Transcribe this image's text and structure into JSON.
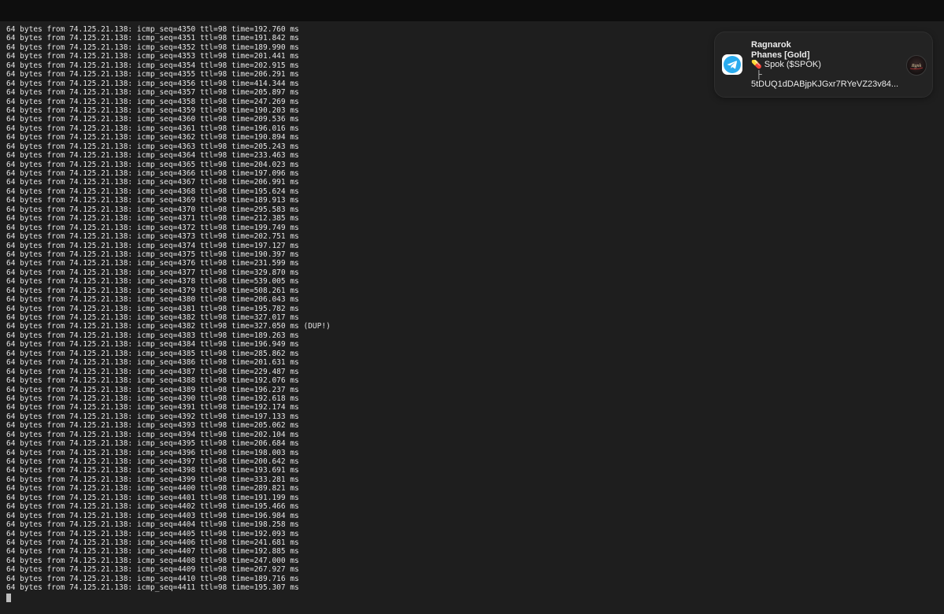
{
  "terminal": {
    "lines": [
      "64 bytes from 74.125.21.138: icmp_seq=4350 ttl=98 time=192.760 ms",
      "64 bytes from 74.125.21.138: icmp_seq=4351 ttl=98 time=191.842 ms",
      "64 bytes from 74.125.21.138: icmp_seq=4352 ttl=98 time=189.990 ms",
      "64 bytes from 74.125.21.138: icmp_seq=4353 ttl=98 time=201.441 ms",
      "64 bytes from 74.125.21.138: icmp_seq=4354 ttl=98 time=202.915 ms",
      "64 bytes from 74.125.21.138: icmp_seq=4355 ttl=98 time=206.291 ms",
      "64 bytes from 74.125.21.138: icmp_seq=4356 ttl=98 time=414.344 ms",
      "64 bytes from 74.125.21.138: icmp_seq=4357 ttl=98 time=205.897 ms",
      "64 bytes from 74.125.21.138: icmp_seq=4358 ttl=98 time=247.269 ms",
      "64 bytes from 74.125.21.138: icmp_seq=4359 ttl=98 time=190.203 ms",
      "64 bytes from 74.125.21.138: icmp_seq=4360 ttl=98 time=209.536 ms",
      "64 bytes from 74.125.21.138: icmp_seq=4361 ttl=98 time=196.016 ms",
      "64 bytes from 74.125.21.138: icmp_seq=4362 ttl=98 time=190.894 ms",
      "64 bytes from 74.125.21.138: icmp_seq=4363 ttl=98 time=205.243 ms",
      "64 bytes from 74.125.21.138: icmp_seq=4364 ttl=98 time=233.463 ms",
      "64 bytes from 74.125.21.138: icmp_seq=4365 ttl=98 time=204.023 ms",
      "64 bytes from 74.125.21.138: icmp_seq=4366 ttl=98 time=197.096 ms",
      "64 bytes from 74.125.21.138: icmp_seq=4367 ttl=98 time=206.991 ms",
      "64 bytes from 74.125.21.138: icmp_seq=4368 ttl=98 time=195.624 ms",
      "64 bytes from 74.125.21.138: icmp_seq=4369 ttl=98 time=189.913 ms",
      "64 bytes from 74.125.21.138: icmp_seq=4370 ttl=98 time=295.583 ms",
      "64 bytes from 74.125.21.138: icmp_seq=4371 ttl=98 time=212.385 ms",
      "64 bytes from 74.125.21.138: icmp_seq=4372 ttl=98 time=199.749 ms",
      "64 bytes from 74.125.21.138: icmp_seq=4373 ttl=98 time=202.751 ms",
      "64 bytes from 74.125.21.138: icmp_seq=4374 ttl=98 time=197.127 ms",
      "64 bytes from 74.125.21.138: icmp_seq=4375 ttl=98 time=190.397 ms",
      "64 bytes from 74.125.21.138: icmp_seq=4376 ttl=98 time=231.599 ms",
      "64 bytes from 74.125.21.138: icmp_seq=4377 ttl=98 time=329.870 ms",
      "64 bytes from 74.125.21.138: icmp_seq=4378 ttl=98 time=539.005 ms",
      "64 bytes from 74.125.21.138: icmp_seq=4379 ttl=98 time=508.261 ms",
      "64 bytes from 74.125.21.138: icmp_seq=4380 ttl=98 time=206.043 ms",
      "64 bytes from 74.125.21.138: icmp_seq=4381 ttl=98 time=195.782 ms",
      "64 bytes from 74.125.21.138: icmp_seq=4382 ttl=98 time=327.017 ms",
      "64 bytes from 74.125.21.138: icmp_seq=4382 ttl=98 time=327.050 ms (DUP!)",
      "64 bytes from 74.125.21.138: icmp_seq=4383 ttl=98 time=189.263 ms",
      "64 bytes from 74.125.21.138: icmp_seq=4384 ttl=98 time=196.949 ms",
      "64 bytes from 74.125.21.138: icmp_seq=4385 ttl=98 time=285.862 ms",
      "64 bytes from 74.125.21.138: icmp_seq=4386 ttl=98 time=201.631 ms",
      "64 bytes from 74.125.21.138: icmp_seq=4387 ttl=98 time=229.487 ms",
      "64 bytes from 74.125.21.138: icmp_seq=4388 ttl=98 time=192.076 ms",
      "64 bytes from 74.125.21.138: icmp_seq=4389 ttl=98 time=196.237 ms",
      "64 bytes from 74.125.21.138: icmp_seq=4390 ttl=98 time=192.618 ms",
      "64 bytes from 74.125.21.138: icmp_seq=4391 ttl=98 time=192.174 ms",
      "64 bytes from 74.125.21.138: icmp_seq=4392 ttl=98 time=197.133 ms",
      "64 bytes from 74.125.21.138: icmp_seq=4393 ttl=98 time=205.062 ms",
      "64 bytes from 74.125.21.138: icmp_seq=4394 ttl=98 time=202.104 ms",
      "64 bytes from 74.125.21.138: icmp_seq=4395 ttl=98 time=206.684 ms",
      "64 bytes from 74.125.21.138: icmp_seq=4396 ttl=98 time=198.003 ms",
      "64 bytes from 74.125.21.138: icmp_seq=4397 ttl=98 time=200.642 ms",
      "64 bytes from 74.125.21.138: icmp_seq=4398 ttl=98 time=193.691 ms",
      "64 bytes from 74.125.21.138: icmp_seq=4399 ttl=98 time=333.281 ms",
      "64 bytes from 74.125.21.138: icmp_seq=4400 ttl=98 time=289.821 ms",
      "64 bytes from 74.125.21.138: icmp_seq=4401 ttl=98 time=191.199 ms",
      "64 bytes from 74.125.21.138: icmp_seq=4402 ttl=98 time=195.466 ms",
      "64 bytes from 74.125.21.138: icmp_seq=4403 ttl=98 time=196.984 ms",
      "64 bytes from 74.125.21.138: icmp_seq=4404 ttl=98 time=198.258 ms",
      "64 bytes from 74.125.21.138: icmp_seq=4405 ttl=98 time=192.093 ms",
      "64 bytes from 74.125.21.138: icmp_seq=4406 ttl=98 time=241.681 ms",
      "64 bytes from 74.125.21.138: icmp_seq=4407 ttl=98 time=192.885 ms",
      "64 bytes from 74.125.21.138: icmp_seq=4408 ttl=98 time=247.000 ms",
      "64 bytes from 74.125.21.138: icmp_seq=4409 ttl=98 time=267.927 ms",
      "64 bytes from 74.125.21.138: icmp_seq=4410 ttl=98 time=189.716 ms",
      "64 bytes from 74.125.21.138: icmp_seq=4411 ttl=98 time=195.307 ms"
    ]
  },
  "notification": {
    "app_icon": "telegram-icon",
    "title": "Ragnarok",
    "subtitle": "Phanes [Gold]",
    "message_emoji": "💊",
    "message_line1": "Spok ($SPOK)",
    "tree_glyph": "├",
    "message_line2": "5tDUQ1dDABjpKJGxr7RYeVZ23v84...",
    "avatar": "ragnarok-avatar-icon"
  },
  "colors": {
    "terminal_bg": "#1e1e1e",
    "terminal_text": "#e6e6e6",
    "titlebar_bg": "#0e0e0e",
    "notification_bg": "#232323",
    "telegram_blue": "#2aabee"
  }
}
